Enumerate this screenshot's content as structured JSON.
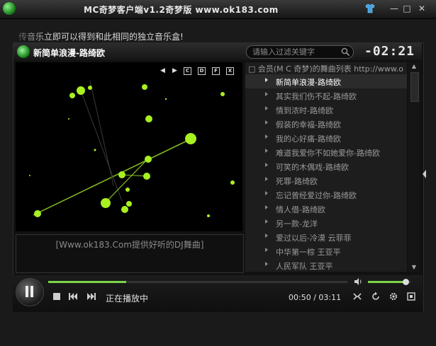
{
  "window": {
    "title": "MC奇梦客户端v1.2奇梦版     www.ok183.com",
    "buttons": {
      "skin": "shirt-icon",
      "minimize": "—",
      "maximize": "□",
      "close": "✕"
    }
  },
  "marquee": "传音乐立即可以得到和此相同的独立音乐盒!",
  "now_playing": {
    "title": "新简单浪漫-路绮欧",
    "time": "-02:21"
  },
  "search": {
    "placeholder": "请输入过滤关键字"
  },
  "visualizer_controls": [
    "◀",
    "▶",
    "C",
    "D",
    "F",
    "X"
  ],
  "promo_text": "[Www.ok183.Com提供好听的DJ舞曲]",
  "playlist": {
    "header": "□ 会员(M C 奇梦)的舞曲列表 http://www.o",
    "items": [
      "新简单浪漫-路绮欧",
      "其实我们伤不起-路绮欧",
      "情到浓时-路绮欧",
      "假装的幸福-路绮欧",
      "我的心好痛-路绮欧",
      "难道我爱你不如她爱你-路绮欧",
      "可笑的木偶戏-路绮欧",
      "死罪-路绮欧",
      "忘记曾经爱过你-路绮欧",
      "情人借-路绮欧",
      "另一款-龙洋",
      "爱过以后-冷漠 云菲菲",
      "中华第一棕 王亚平",
      "人民军队 王亚平"
    ],
    "active_index": 0
  },
  "player": {
    "status": "正在播放中",
    "time_display": "00:50 / 03:11",
    "progress_fraction": 0.26,
    "volume_fraction": 0.9
  },
  "colors": {
    "accent": "#7ad64a",
    "particle": "#a8f020",
    "line": "#88c020"
  }
}
